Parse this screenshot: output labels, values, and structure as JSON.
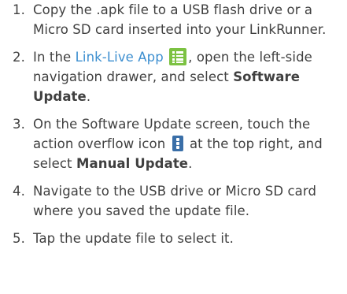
{
  "steps": [
    {
      "num": "1.",
      "text": "Copy the .apk file to a USB flash drive or a Micro SD card inserted into your LinkRunner."
    },
    {
      "num": "2.",
      "text_before_link": "In the ",
      "link": "Link-Live App",
      "icon": "link-live-app-icon",
      "text_after_icon": ", open the left-side navigation drawer, and select ",
      "bold": "Software Update",
      "text_end": "."
    },
    {
      "num": "3.",
      "text_before_icon": "On the Software Update screen, touch the action overflow icon ",
      "icon": "action-overflow-icon",
      "text_after_icon": " at the top right, and select ",
      "bold": "Manual Update",
      "text_end": "."
    },
    {
      "num": "4.",
      "text": "Navigate to the USB drive or Micro SD card where you saved the update file."
    },
    {
      "num": "5.",
      "text": "Tap the update file to select it."
    }
  ],
  "colors": {
    "text": "#404040",
    "link": "#3d8fd0",
    "app_icon": "#7cc242",
    "overflow_icon": "#3a6fa8"
  }
}
